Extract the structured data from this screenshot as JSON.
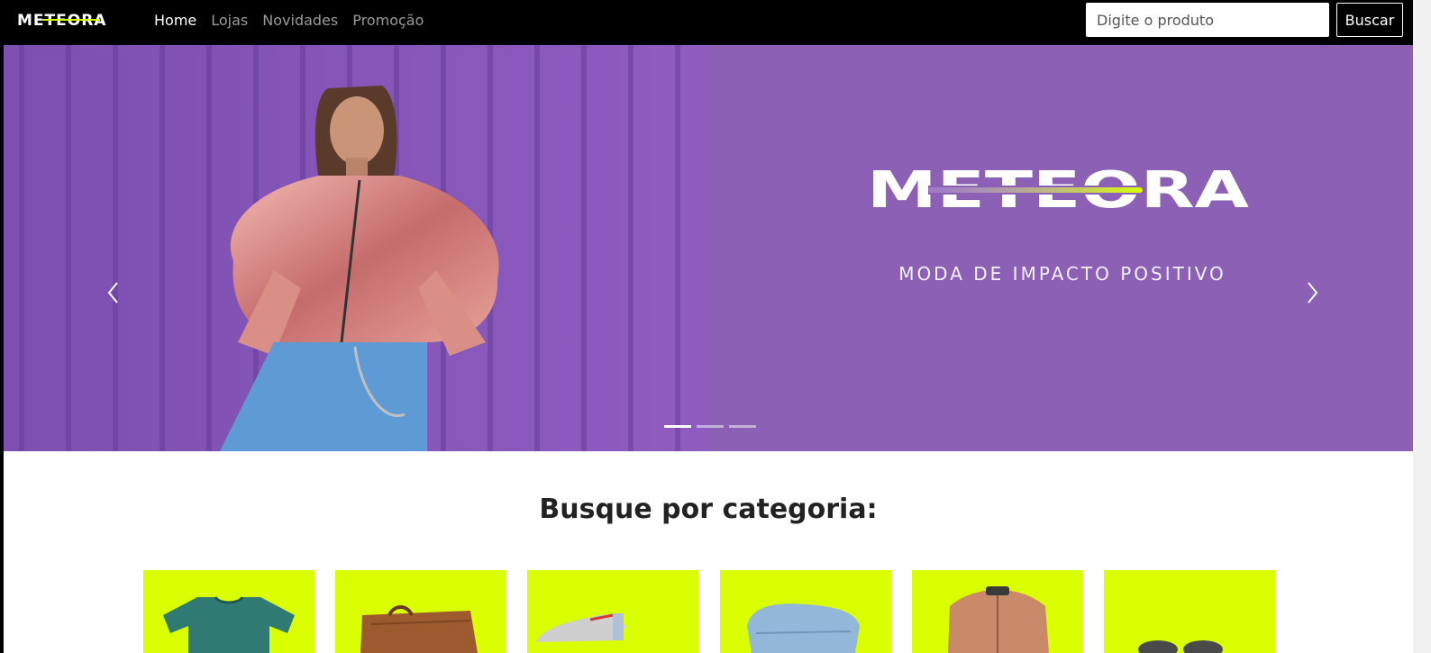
{
  "brand": {
    "name": "METEORA"
  },
  "nav": {
    "links": [
      {
        "label": "Home",
        "active": true
      },
      {
        "label": "Lojas",
        "active": false
      },
      {
        "label": "Novidades",
        "active": false
      },
      {
        "label": "Promoção",
        "active": false
      }
    ]
  },
  "search": {
    "placeholder": "Digite o produto",
    "button_label": "Buscar"
  },
  "hero": {
    "logo_text": "METEORA",
    "tagline": "MODA DE IMPACTO POSITIVO",
    "slide_count": 3,
    "active_slide": 1,
    "background_color": "#8b60b5"
  },
  "categories": {
    "title": "Busque por categoria:",
    "card_color": "#d9ff00",
    "items": [
      {
        "icon": "tshirt-icon"
      },
      {
        "icon": "handbag-icon"
      },
      {
        "icon": "sneaker-icon"
      },
      {
        "icon": "jeans-icon"
      },
      {
        "icon": "jacket-icon"
      },
      {
        "icon": "sunglasses-icon"
      }
    ]
  },
  "colors": {
    "navbar": "#000000",
    "accent": "#d9ff00",
    "hero": "#8b60b5"
  }
}
